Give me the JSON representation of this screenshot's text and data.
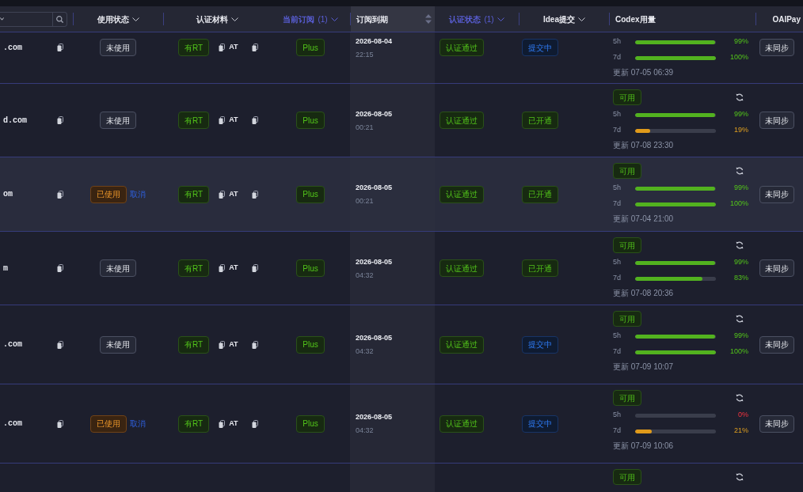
{
  "table": {
    "columns": [
      {
        "label": "使用状态",
        "kind": "filter",
        "filtered": false,
        "sorted": false
      },
      {
        "label": "认证材料",
        "kind": "filter",
        "filtered": false,
        "sorted": false
      },
      {
        "label": "当前订阅",
        "count": "(1)",
        "kind": "filter",
        "filtered": true,
        "sorted": false
      },
      {
        "label": "订阅到期",
        "kind": "sort",
        "filtered": false,
        "sorted": true
      },
      {
        "label": "认证状态",
        "count": "(1)",
        "kind": "filter",
        "filtered": true,
        "sorted": false
      },
      {
        "label": "Idea提交",
        "kind": "filter",
        "filtered": false,
        "sorted": false
      },
      {
        "label": "Codex用量",
        "kind": "plain",
        "filtered": false,
        "sorted": false
      },
      {
        "label": "OAIPay",
        "kind": "plain",
        "filtered": false,
        "sorted": false
      }
    ],
    "rows": [
      {
        "email": ".com",
        "usage": {
          "label": "未使用",
          "used": false
        },
        "rt": "有RT",
        "at": "AT",
        "plan": "Plus",
        "expiry": {
          "date": "2026-08-04",
          "time": "22:15"
        },
        "auth": "认证通过",
        "idea": {
          "label": "提交中",
          "kind": "pending"
        },
        "meters": [
          {
            "label": "5h",
            "level": 0.99,
            "reading": "99%"
          },
          {
            "label": "7d",
            "level": 1,
            "reading": "100%"
          }
        ],
        "updated": "更新 07-05 06:39",
        "sync": "未同步",
        "highlighted": false
      },
      {
        "email": "d.com",
        "usage": {
          "label": "未使用",
          "used": false
        },
        "rt": "有RT",
        "at": "AT",
        "plan": "Plus",
        "expiry": {
          "date": "2026-08-05",
          "time": "00:21"
        },
        "auth": "认证通过",
        "idea": {
          "label": "已开通",
          "kind": "enabled"
        },
        "availability": "可用",
        "meters": [
          {
            "label": "5h",
            "level": 0.99,
            "reading": "99%"
          },
          {
            "label": "7d",
            "level": 0.19,
            "reading": "19%"
          }
        ],
        "updated": "更新 07-08 23:30",
        "sync": "未同步",
        "highlighted": false
      },
      {
        "email": "om",
        "usage": {
          "label": "已使用",
          "used": true
        },
        "cancel": "取消",
        "rt": "有RT",
        "at": "AT",
        "plan": "Plus",
        "expiry": {
          "date": "2026-08-05",
          "time": "00:21"
        },
        "auth": "认证通过",
        "idea": {
          "label": "已开通",
          "kind": "enabled"
        },
        "availability": "可用",
        "meters": [
          {
            "label": "5h",
            "level": 0.99,
            "reading": "99%"
          },
          {
            "label": "7d",
            "level": 1,
            "reading": "100%"
          }
        ],
        "updated": "更新 07-04 21:00",
        "sync": "未同步",
        "highlighted": true
      },
      {
        "email": "m",
        "usage": {
          "label": "未使用",
          "used": false
        },
        "rt": "有RT",
        "at": "AT",
        "plan": "Plus",
        "expiry": {
          "date": "2026-08-05",
          "time": "04:32"
        },
        "auth": "认证通过",
        "idea": {
          "label": "已开通",
          "kind": "enabled"
        },
        "availability": "可用",
        "meters": [
          {
            "label": "5h",
            "level": 0.99,
            "reading": "99%"
          },
          {
            "label": "7d",
            "level": 0.83,
            "reading": "83%"
          }
        ],
        "updated": "更新 07-08 20:36",
        "sync": "未同步",
        "highlighted": false
      },
      {
        "email": ".com",
        "usage": {
          "label": "未使用",
          "used": false
        },
        "rt": "有RT",
        "at": "AT",
        "plan": "Plus",
        "expiry": {
          "date": "2026-08-05",
          "time": "04:32"
        },
        "auth": "认证通过",
        "idea": {
          "label": "提交中",
          "kind": "pending"
        },
        "availability": "可用",
        "meters": [
          {
            "label": "5h",
            "level": 0.99,
            "reading": "99%"
          },
          {
            "label": "7d",
            "level": 1,
            "reading": "100%"
          }
        ],
        "updated": "更新 07-09 10:07",
        "sync": "未同步",
        "highlighted": false
      },
      {
        "email": ".com",
        "usage": {
          "label": "已使用",
          "used": true
        },
        "cancel": "取消",
        "rt": "有RT",
        "at": "AT",
        "plan": "Plus",
        "expiry": {
          "date": "2026-08-05",
          "time": "04:32"
        },
        "auth": "认证通过",
        "idea": {
          "label": "提交中",
          "kind": "pending"
        },
        "availability": "可用",
        "meters": [
          {
            "label": "5h",
            "level": 0,
            "reading": "0%"
          },
          {
            "label": "7d",
            "level": 0.21,
            "reading": "21%"
          }
        ],
        "updated": "更新 07-09 10:06",
        "sync": "未同步",
        "highlighted": false
      },
      {
        "availability": "可用",
        "highlighted": false
      }
    ]
  }
}
